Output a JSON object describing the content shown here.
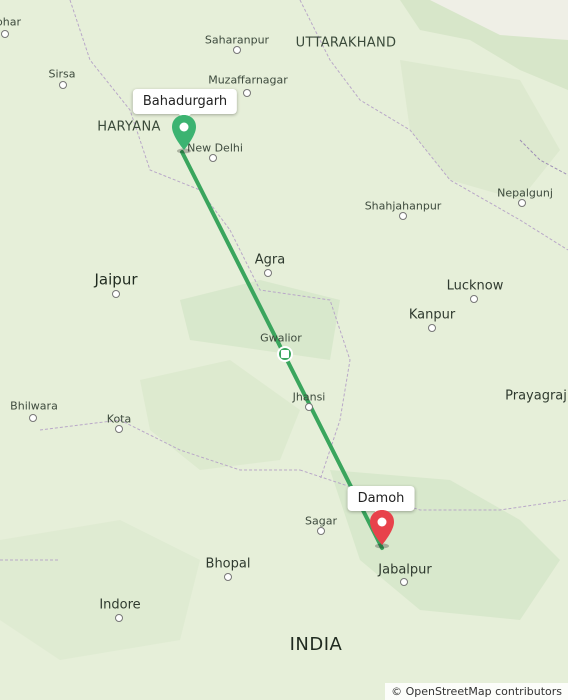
{
  "map": {
    "route_color": "#3aa55d",
    "start_pin_color": "#3cb371",
    "end_pin_color": "#e8424b",
    "base_color": "#e6efd9",
    "border_color": "#b9a8c8"
  },
  "states": {
    "uttarakhand": "UTTARAKHAND",
    "haryana": "HARYANA",
    "india": "INDIA"
  },
  "cities": {
    "saharanpur": "Saharanpur",
    "muzaffarnagar": "Muzaffarnagar",
    "sirsa": "Sirsa",
    "new_delhi": "New Delhi",
    "shahjahanpur": "Shahjahanpur",
    "nepalgunj": "Nepalgunj",
    "agra": "Agra",
    "jaipur": "Jaipur",
    "lucknow": "Lucknow",
    "kanpur": "Kanpur",
    "gwalior": "Gwalior",
    "bhilwara": "Bhilwara",
    "kota": "Kota",
    "jhansi": "Jhansi",
    "prayagraj": "Prayagraj",
    "sagar": "Sagar",
    "jabalpur": "Jabalpur",
    "bhopal": "Bhopal",
    "indore": "Indore",
    "ophar": "ophar"
  },
  "markers": {
    "start": "Bahadurgarh",
    "end": "Damoh"
  },
  "attribution": "© OpenStreetMap contributors"
}
